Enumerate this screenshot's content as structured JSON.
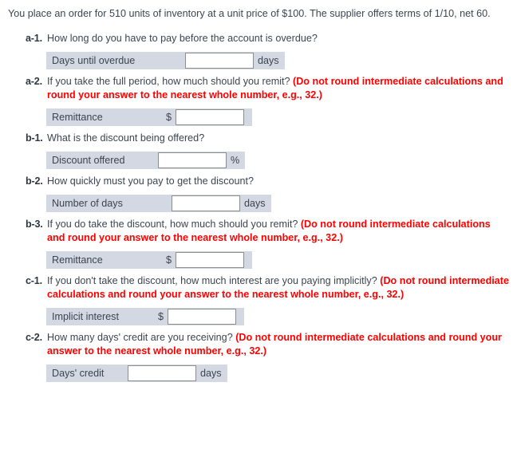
{
  "stem": "You place an order for 510 units of inventory at a unit price of $100. The supplier offers terms of 1/10, net 60.",
  "hint_text": "(Do not round intermediate calculations and round your answer to the nearest whole number, e.g., 32.)",
  "colors": {
    "row_background": "#d3d8e2",
    "hint_red": "#ff0000",
    "body_text": "#3d4450",
    "input_border": "#8d8d8d",
    "input_background": "#ffffff"
  },
  "questions": [
    {
      "number": "a-1.",
      "text": "How long do you have to pay before the account is overdue?",
      "hint": "",
      "justify": false,
      "answer": {
        "label": "Days until overdue",
        "symbol": "",
        "unit": "days",
        "value": "",
        "label_width": 174,
        "symbol_width": 0,
        "input_width": 86,
        "trailing_pad": false
      }
    },
    {
      "number": "a-2.",
      "text": "If you take the full period, how much should you remit? ",
      "hint": "(Do not round intermediate calculations and round your answer to the nearest whole number, e.g., 32.)",
      "justify": false,
      "answer": {
        "label": "Remittance",
        "symbol": "$",
        "unit": "",
        "value": "",
        "label_width": 140,
        "symbol_width": 22,
        "input_width": 86,
        "trailing_pad": true
      }
    },
    {
      "number": "b-1.",
      "text": "What is the discount being offered?",
      "hint": "",
      "justify": false,
      "answer": {
        "label": "Discount offered",
        "symbol": "",
        "unit": "%",
        "value": "",
        "label_width": 140,
        "symbol_width": 0,
        "input_width": 86,
        "trailing_pad": false
      }
    },
    {
      "number": "b-2.",
      "text": "How quickly must you pay to get the discount?",
      "hint": "",
      "justify": false,
      "answer": {
        "label": "Number of days",
        "symbol": "",
        "unit": "days",
        "value": "",
        "label_width": 157,
        "symbol_width": 0,
        "input_width": 86,
        "trailing_pad": false
      }
    },
    {
      "number": "b-3.",
      "text": "If you do take the discount, how much should you remit? ",
      "hint": "(Do not round intermediate calculations and round your answer to the nearest whole number, e.g., 32.)",
      "justify": false,
      "answer": {
        "label": "Remittance",
        "symbol": "$",
        "unit": "",
        "value": "",
        "label_width": 140,
        "symbol_width": 22,
        "input_width": 86,
        "trailing_pad": true
      }
    },
    {
      "number": "c-1.",
      "text": "If you don't take the discount, how much interest are you paying implicitly? ",
      "hint": "(Do not round intermediate calculations and round your answer to the nearest whole number, e.g., 32.)",
      "justify": true,
      "answer": {
        "label": "Implicit interest",
        "symbol": "$",
        "unit": "",
        "value": "",
        "label_width": 130,
        "symbol_width": 22,
        "input_width": 86,
        "trailing_pad": true
      }
    },
    {
      "number": "c-2.",
      "text": "How many days' credit are you receiving? ",
      "hint": "(Do not round intermediate calculations and round your answer to the nearest whole number, e.g., 32.)",
      "justify": false,
      "answer": {
        "label": "Days' credit",
        "symbol": "",
        "unit": "days",
        "value": "",
        "label_width": 102,
        "symbol_width": 0,
        "input_width": 86,
        "trailing_pad": false
      }
    }
  ]
}
